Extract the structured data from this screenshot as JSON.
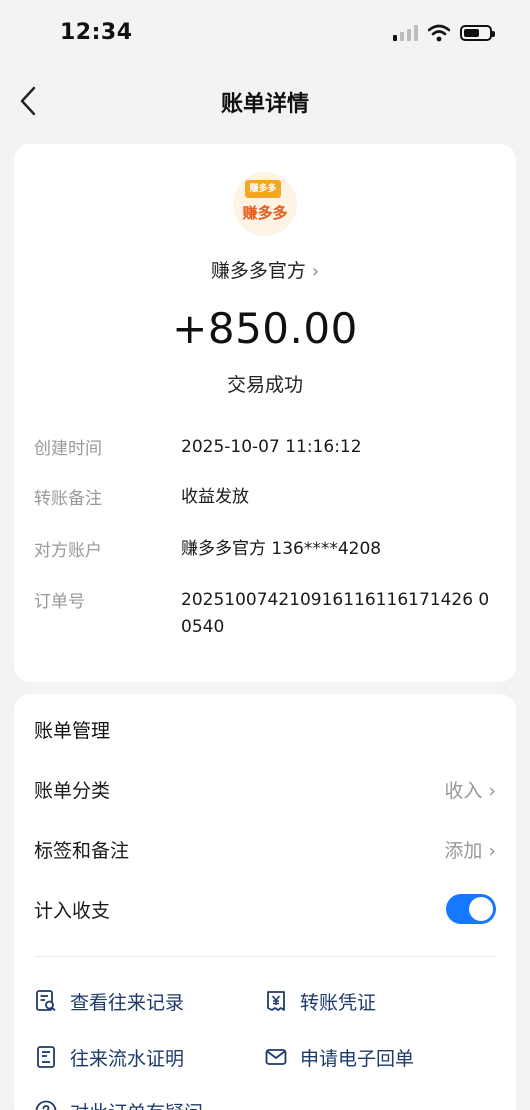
{
  "status_bar": {
    "time": "12:34"
  },
  "nav": {
    "title": "账单详情"
  },
  "merchant": {
    "logo_tag": "赚多多",
    "logo_name": "赚多多",
    "name": "赚多多官方",
    "amount": "+850.00",
    "status": "交易成功"
  },
  "details": [
    {
      "key": "创建时间",
      "value": "2025-10-07 11:16:12"
    },
    {
      "key": "转账备注",
      "value": "收益发放"
    },
    {
      "key": "对方账户",
      "value": "赚多多官方 136****4208"
    },
    {
      "key": "订单号",
      "value": "202510074210916116116171426 00540"
    }
  ],
  "management": {
    "title": "账单管理",
    "category_label": "账单分类",
    "category_value": "收入",
    "tag_label": "标签和备注",
    "tag_value": "添加",
    "include_label": "计入收支",
    "include_on": true
  },
  "actions": [
    {
      "label": "查看往来记录",
      "icon": "records-icon"
    },
    {
      "label": "转账凭证",
      "icon": "yuan-receipt-icon"
    },
    {
      "label": "往来流水证明",
      "icon": "statement-icon"
    },
    {
      "label": "申请电子回单",
      "icon": "mail-icon"
    },
    {
      "label": "对此订单有疑问",
      "icon": "question-icon"
    }
  ],
  "colors": {
    "accent": "#1677ff",
    "action_text": "#1e3a6a",
    "logo_orange": "#e8591a"
  }
}
